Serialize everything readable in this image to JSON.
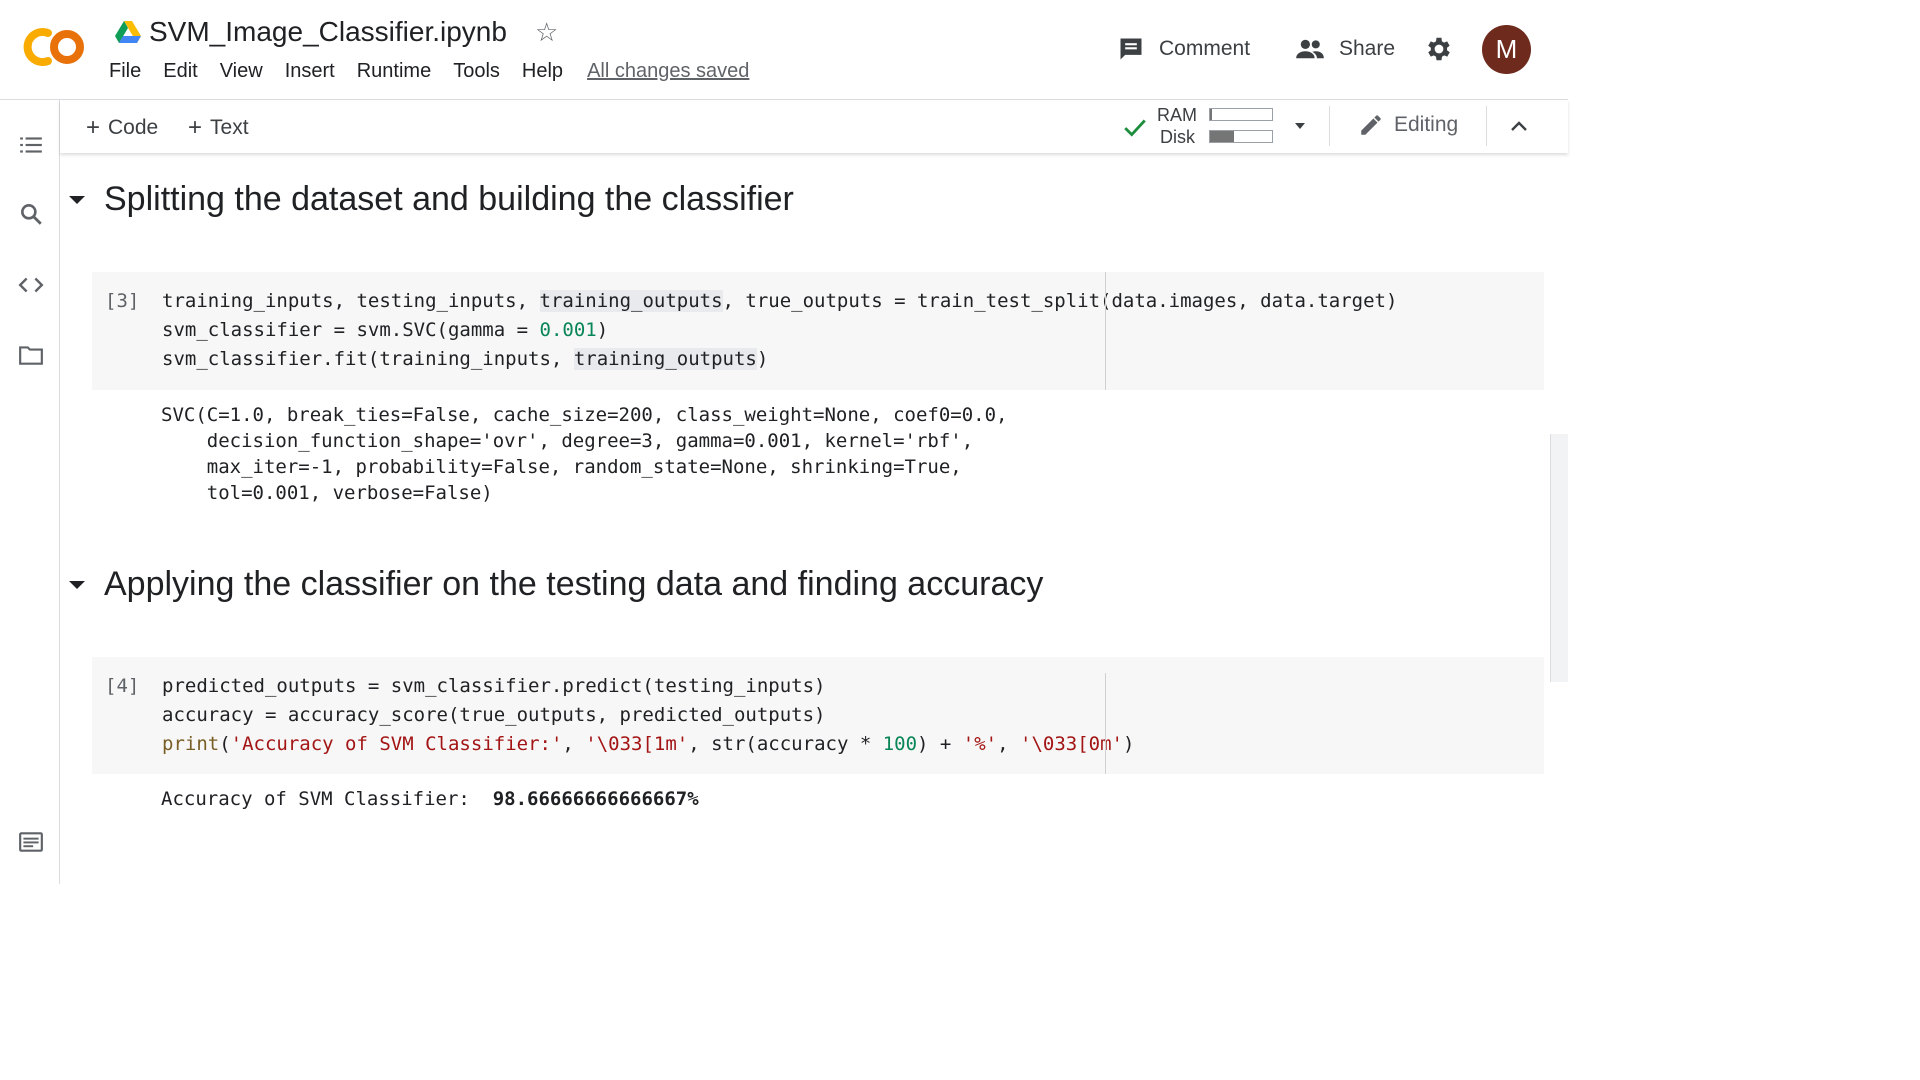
{
  "header": {
    "notebook_title": "SVM_Image_Classifier.ipynb",
    "menu": [
      "File",
      "Edit",
      "View",
      "Insert",
      "Runtime",
      "Tools",
      "Help"
    ],
    "save_status": "All changes saved",
    "comment_label": "Comment",
    "share_label": "Share",
    "avatar_initial": "M",
    "avatar_color": "#6d2a1d"
  },
  "toolbar": {
    "add_code_label": "Code",
    "add_text_label": "Text",
    "ram_label": "RAM",
    "disk_label": "Disk",
    "ram_usage": 0.04,
    "disk_usage": 0.38,
    "editing_label": "Editing"
  },
  "left_rail": {
    "icons": [
      "toc-icon",
      "search-icon",
      "code-snippets-icon",
      "folder-icon",
      "terminal-icon"
    ]
  },
  "sections": [
    {
      "heading": "Splitting the dataset and building the classifier"
    },
    {
      "heading": "Applying the classifier on the testing data and finding accuracy"
    }
  ],
  "cells": [
    {
      "execution_count": "[3]",
      "code": [
        "training_inputs, testing_inputs, training_outputs, true_outputs = train_test_split(data.images, data.target)",
        "svm_classifier = svm.SVC(gamma = 0.001)",
        "svm_classifier.fit(training_inputs, training_outputs)"
      ],
      "output": [
        "SVC(C=1.0, break_ties=False, cache_size=200, class_weight=None, coef0=0.0,",
        "    decision_function_shape='ovr', degree=3, gamma=0.001, kernel='rbf',",
        "    max_iter=-1, probability=False, random_state=None, shrinking=True,",
        "    tol=0.001, verbose=False)"
      ]
    },
    {
      "execution_count": "[4]",
      "code": [
        "predicted_outputs = svm_classifier.predict(testing_inputs)",
        "accuracy = accuracy_score(true_outputs, predicted_outputs)",
        "print('Accuracy of SVM Classifier:', '\\033[1m', str(accuracy * 100) + '%', '\\033[0m')"
      ],
      "output_label": "Accuracy of SVM Classifier:  ",
      "output_value": "98.66666666666667%"
    }
  ],
  "colors": {
    "string": "#a31515",
    "number": "#098658",
    "builtin": "#795e26",
    "logo_orange": "#f9ab00",
    "logo_dark_orange": "#e8710a"
  }
}
